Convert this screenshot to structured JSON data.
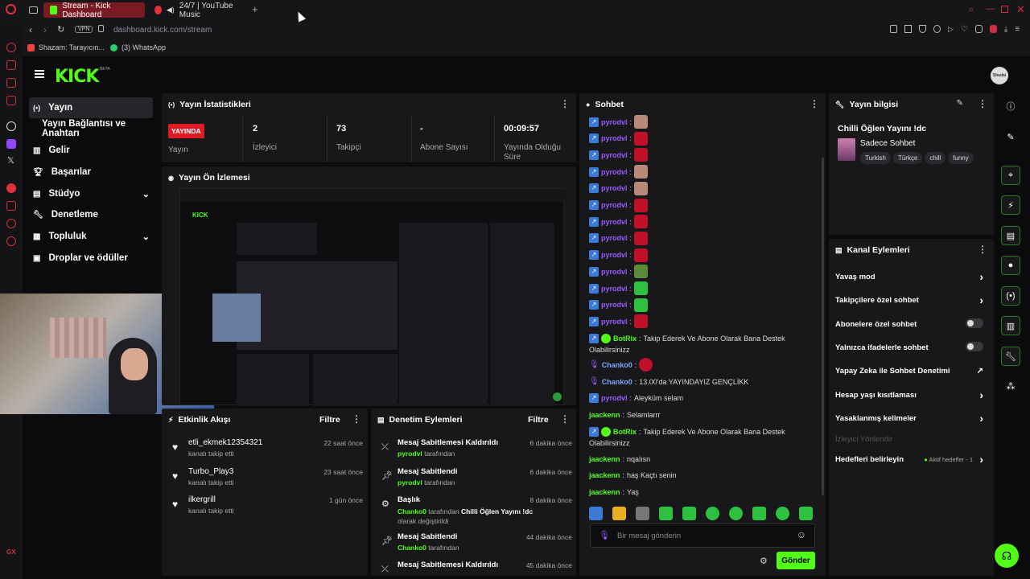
{
  "browser": {
    "tabs": [
      {
        "label": "Stream - Kick Dashboard"
      },
      {
        "label": "24/7 | YouTube Music"
      }
    ],
    "vpn": "VPN",
    "url": "dashboard.kick.com/stream",
    "bookmarks": [
      {
        "label": "Shazam: Tarayıcın..."
      },
      {
        "label": "(3) WhatsApp"
      }
    ]
  },
  "header": {
    "logo": "KICK",
    "beta": "BETA",
    "avatar_text": "Shadai"
  },
  "nav": {
    "items": [
      {
        "label": "Yayın"
      },
      {
        "label": "Yayın Bağlantısı ve Anahtarı"
      },
      {
        "label": "Gelir"
      },
      {
        "label": "Başarılar"
      },
      {
        "label": "Stüdyo"
      },
      {
        "label": "Denetleme"
      },
      {
        "label": "Topluluk"
      },
      {
        "label": "Droplar ve ödüller"
      }
    ]
  },
  "stats": {
    "title": "Yayın İstatistikleri",
    "live": "YAYINDA",
    "items": [
      {
        "label": "Yayın",
        "value": ""
      },
      {
        "label": "İzleyici",
        "value": "2"
      },
      {
        "label": "Takipçi",
        "value": "73"
      },
      {
        "label": "Abone Sayısı",
        "value": "-"
      },
      {
        "label": "Yayında Olduğu Süre",
        "value": "00:09:57"
      }
    ]
  },
  "preview": {
    "title": "Yayın Ön İzlemesi"
  },
  "activity": {
    "title": "Etkinlik Akışı",
    "filter": "Filtre",
    "items": [
      {
        "name": "etli_ekmek12354321",
        "sub": "kanalı takip etti",
        "time": "22 saat önce"
      },
      {
        "name": "Turbo_Play3",
        "sub": "kanalı takip etti",
        "time": "23 saat önce"
      },
      {
        "name": "ilkergrill",
        "sub": "kanalı takip etti",
        "time": "1 gün önce"
      }
    ]
  },
  "modlog": {
    "title": "Denetim Eylemleri",
    "filter": "Filtre",
    "items": [
      {
        "title": "Mesaj Sabitlemesi Kaldırıldı",
        "user": "pyrodvl",
        "suffix": "tarafından",
        "time": "6 dakika önce"
      },
      {
        "title": "Mesaj Sabitlendi",
        "user": "pyrodvl",
        "suffix": "tarafından",
        "time": "6 dakika önce"
      },
      {
        "title": "Başlık",
        "user": "Chanko0",
        "suffix": "tarafından",
        "extra": "Chilli Öğlen Yayını !dc",
        "extra2": "olarak",
        "extra3": "değiştirildi",
        "time": "8 dakika önce"
      },
      {
        "title": "Mesaj Sabitlendi",
        "user": "Chanko0",
        "suffix": "tarafından",
        "time": "44 dakika önce"
      },
      {
        "title": "Mesaj Sabitlemesi Kaldırıldı",
        "user": "",
        "suffix": "",
        "time": "45 dakika önce"
      }
    ]
  },
  "chat": {
    "title": "Sohbet",
    "messages": [
      {
        "user": "pyrodvl",
        "text": ""
      },
      {
        "user": "pyrodvl",
        "text": ""
      },
      {
        "user": "pyrodvl",
        "text": ""
      },
      {
        "user": "pyrodvl",
        "text": ""
      },
      {
        "user": "pyrodvl",
        "text": ""
      },
      {
        "user": "pyrodvl",
        "text": ""
      },
      {
        "user": "pyrodvl",
        "text": ""
      },
      {
        "user": "pyrodvl",
        "text": ""
      },
      {
        "user": "pyrodvl",
        "text": ""
      },
      {
        "user": "pyrodvl",
        "text": ""
      },
      {
        "user": "pyrodvl",
        "text": ""
      },
      {
        "user": "pyrodvl",
        "text": ""
      },
      {
        "user": "pyrodvl",
        "text": ""
      }
    ],
    "botrix1_user": "BotRix",
    "botrix1_text": "Takip Ederek Ve Abone Olarak Bana Destek",
    "botrix1_text2": "Olabilirsinizz",
    "chanko1_user": "Chanko0",
    "chanko2_user": "Chanko0",
    "chanko2_text": "13.00'da YAYINDAYIZ GENÇLİKK",
    "pyro_last_user": "pyrodvl",
    "pyro_last_text": "Aleyküm selam",
    "jack1_user": "jaackenn",
    "jack1_text": "Selamlarrr",
    "botrix2_user": "BotRix",
    "botrix2_text": "Takip Ederek Ve Abone Olarak Bana Destek",
    "botrix2_text2": "Olabilirsinizz",
    "jack2_user": "jaackenn",
    "jack2_text": "nqalısn",
    "jack3_user": "jaackenn",
    "jack3_text": "haş Kaçtı senin",
    "jack4_user": "jaackenn",
    "jack4_text": "Yaş",
    "input_placeholder": "Bir mesaj gönderin",
    "send": "Gönder"
  },
  "info": {
    "title": "Yayın bilgisi",
    "stream_title": "Chilli Öğlen Yayını !dc",
    "category": "Sadece Sohbet",
    "tags": [
      "Turkish",
      "Türkçe",
      "chill",
      "funny"
    ]
  },
  "channel_actions": {
    "title": "Kanal Eylemleri",
    "items": [
      {
        "label": "Yavaş mod",
        "type": "chevron"
      },
      {
        "label": "Takipçilere özel sohbet",
        "type": "chevron"
      },
      {
        "label": "Abonelere özel sohbet",
        "type": "toggle"
      },
      {
        "label": "Yalnızca ifadelerle sohbet",
        "type": "toggle"
      },
      {
        "label": "Yapay Zeka ile Sohbet Denetimi",
        "type": "external"
      },
      {
        "label": "Hesap yaşı kısıtlaması",
        "type": "chevron"
      },
      {
        "label": "Yasaklanmış kelimeler",
        "type": "chevron"
      },
      {
        "label": "İzleyici Yönlendir",
        "type": "disabled"
      },
      {
        "label": "Hedefleri belirleyin",
        "type": "chevron"
      }
    ],
    "goals_active": "Aktif hedefler - 1"
  }
}
